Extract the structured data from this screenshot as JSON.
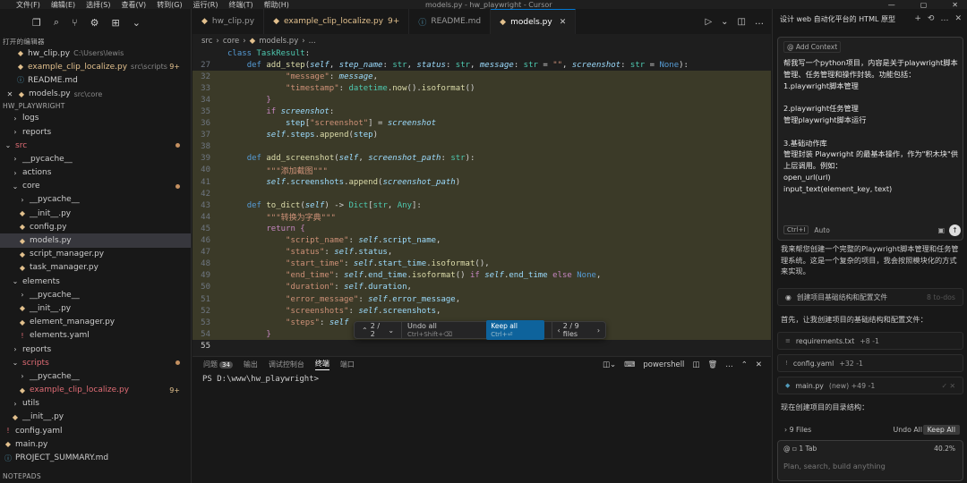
{
  "titlebar": {
    "menu": [
      "文件(F)",
      "编辑(E)",
      "选择(S)",
      "查看(V)",
      "转到(G)",
      "运行(R)",
      "终端(T)",
      "帮助(H)"
    ],
    "title": "models.py - hw_playwright - Cursor"
  },
  "explorer": {
    "open_editors_header": "打开的编辑器",
    "open_editors": [
      {
        "name": "hw_clip.py",
        "path": "C:\\Users\\lewis",
        "badge": ""
      },
      {
        "name": "example_clip_localize.py",
        "path": "src\\scripts",
        "badge": "9+"
      },
      {
        "name": "README.md",
        "path": "",
        "badge": ""
      },
      {
        "name": "models.py",
        "path": "src\\core",
        "badge": ""
      }
    ],
    "project_header": "HW_PLAYWRIGHT",
    "tree": [
      {
        "name": "logs",
        "indent": 1,
        "kind": "folder"
      },
      {
        "name": "reports",
        "indent": 1,
        "kind": "folder"
      },
      {
        "name": "src",
        "indent": 0,
        "kind": "folder-open"
      },
      {
        "name": "__pycache__",
        "indent": 1,
        "kind": "folder"
      },
      {
        "name": "actions",
        "indent": 1,
        "kind": "folder"
      },
      {
        "name": "core",
        "indent": 1,
        "kind": "folder-open"
      },
      {
        "name": "__pycache__",
        "indent": 2,
        "kind": "folder"
      },
      {
        "name": "__init__.py",
        "indent": 2,
        "kind": "py"
      },
      {
        "name": "config.py",
        "indent": 2,
        "kind": "py"
      },
      {
        "name": "models.py",
        "indent": 2,
        "kind": "py"
      },
      {
        "name": "script_manager.py",
        "indent": 2,
        "kind": "py"
      },
      {
        "name": "task_manager.py",
        "indent": 2,
        "kind": "py"
      },
      {
        "name": "elements",
        "indent": 1,
        "kind": "folder-open"
      },
      {
        "name": "__pycache__",
        "indent": 2,
        "kind": "folder"
      },
      {
        "name": "__init__.py",
        "indent": 2,
        "kind": "py"
      },
      {
        "name": "element_manager.py",
        "indent": 2,
        "kind": "py"
      },
      {
        "name": "elements.yaml",
        "indent": 2,
        "kind": "yaml"
      },
      {
        "name": "reports",
        "indent": 1,
        "kind": "folder"
      },
      {
        "name": "scripts",
        "indent": 1,
        "kind": "folder-open"
      },
      {
        "name": "__pycache__",
        "indent": 2,
        "kind": "folder"
      },
      {
        "name": "example_clip_localize.py",
        "indent": 2,
        "kind": "py"
      },
      {
        "name": "utils",
        "indent": 1,
        "kind": "folder"
      },
      {
        "name": "__init__.py",
        "indent": 1,
        "kind": "py"
      },
      {
        "name": "config.yaml",
        "indent": 0,
        "kind": "yaml"
      },
      {
        "name": "main.py",
        "indent": 0,
        "kind": "py"
      },
      {
        "name": "PROJECT_SUMMARY.md",
        "indent": 0,
        "kind": "md"
      }
    ],
    "tree_badge": "9+",
    "notepads_header": "NOTEPADS"
  },
  "tabs": [
    {
      "name": "hw_clip.py",
      "mod": ""
    },
    {
      "name": "example_clip_localize.py",
      "mod": "9+"
    },
    {
      "name": "README.md",
      "mod": ""
    },
    {
      "name": "models.py",
      "mod": ""
    }
  ],
  "breadcrumb": [
    "src",
    "core",
    "models.py",
    "..."
  ],
  "code": {
    "class_line": "class TaskResult:",
    "sticky_line_no": "27",
    "line_numbers": [
      "32",
      "33",
      "34",
      "35",
      "36",
      "37",
      "38",
      "39",
      "40",
      "41",
      "42",
      "43",
      "44",
      "45",
      "46",
      "47",
      "48",
      "49",
      "50",
      "51",
      "52",
      "53",
      "54",
      "55"
    ]
  },
  "floatbar": {
    "nav": "2 / 2",
    "undo": "Undo all",
    "undo_key": "Ctrl+Shift+⌫",
    "keep": "Keep all",
    "keep_key": "Ctrl+⏎",
    "files": "2 / 9 files"
  },
  "panel": {
    "tabs": [
      "问题",
      "输出",
      "调试控制台",
      "终端",
      "端口"
    ],
    "problems_count": "34",
    "shell": "powershell",
    "prompt": "PS D:\\www\\hw_playwright>"
  },
  "chat": {
    "title": "设计 web 自动化平台的 HTML 原型",
    "add_context": "@ Add Context",
    "prompt_text": "帮我写一个python项目，内容是关于playwright脚本管理、任务管理和操作封装。功能包括：\n1.playwright脚本管理\n\n2.playwright任务管理\n管理playwright脚本运行\n\n3.基础动作库\n管理封装 Playwright 的最基本操作，作为\"积木块\"供上层调用。例如：\nopen_url(url)\ninput_text(element_key, text)",
    "mode_key": "Ctrl+I",
    "mode": "Auto",
    "response1": "我来帮您创建一个完整的Playwright脚本管理和任务管理系统。这是一个复杂的项目，我会按照模块化的方式来实现。",
    "step1": "创建项目基础结构和配置文件",
    "step1_status": "8 to-dos",
    "response2": "首先，让我创建项目的基础结构和配置文件：",
    "files": [
      {
        "name": "requirements.txt",
        "diff": "+8 -1"
      },
      {
        "name": "config.yaml",
        "diff": "+32 -1"
      },
      {
        "name": "main.py",
        "diff": "(new) +49 -1"
      }
    ],
    "response3": "现在创建项目的目录结构：",
    "files_count": "9 Files",
    "undo_all": "Undo All",
    "keep_all": "Keep All",
    "tab_chip": "1 Tab",
    "zoom": "40.2%",
    "placeholder": "Plan, search, build anything"
  },
  "colors": {
    "accent": "#0078d4",
    "modified": "#e2c08d",
    "diff_highlight": "#3b3a28"
  }
}
